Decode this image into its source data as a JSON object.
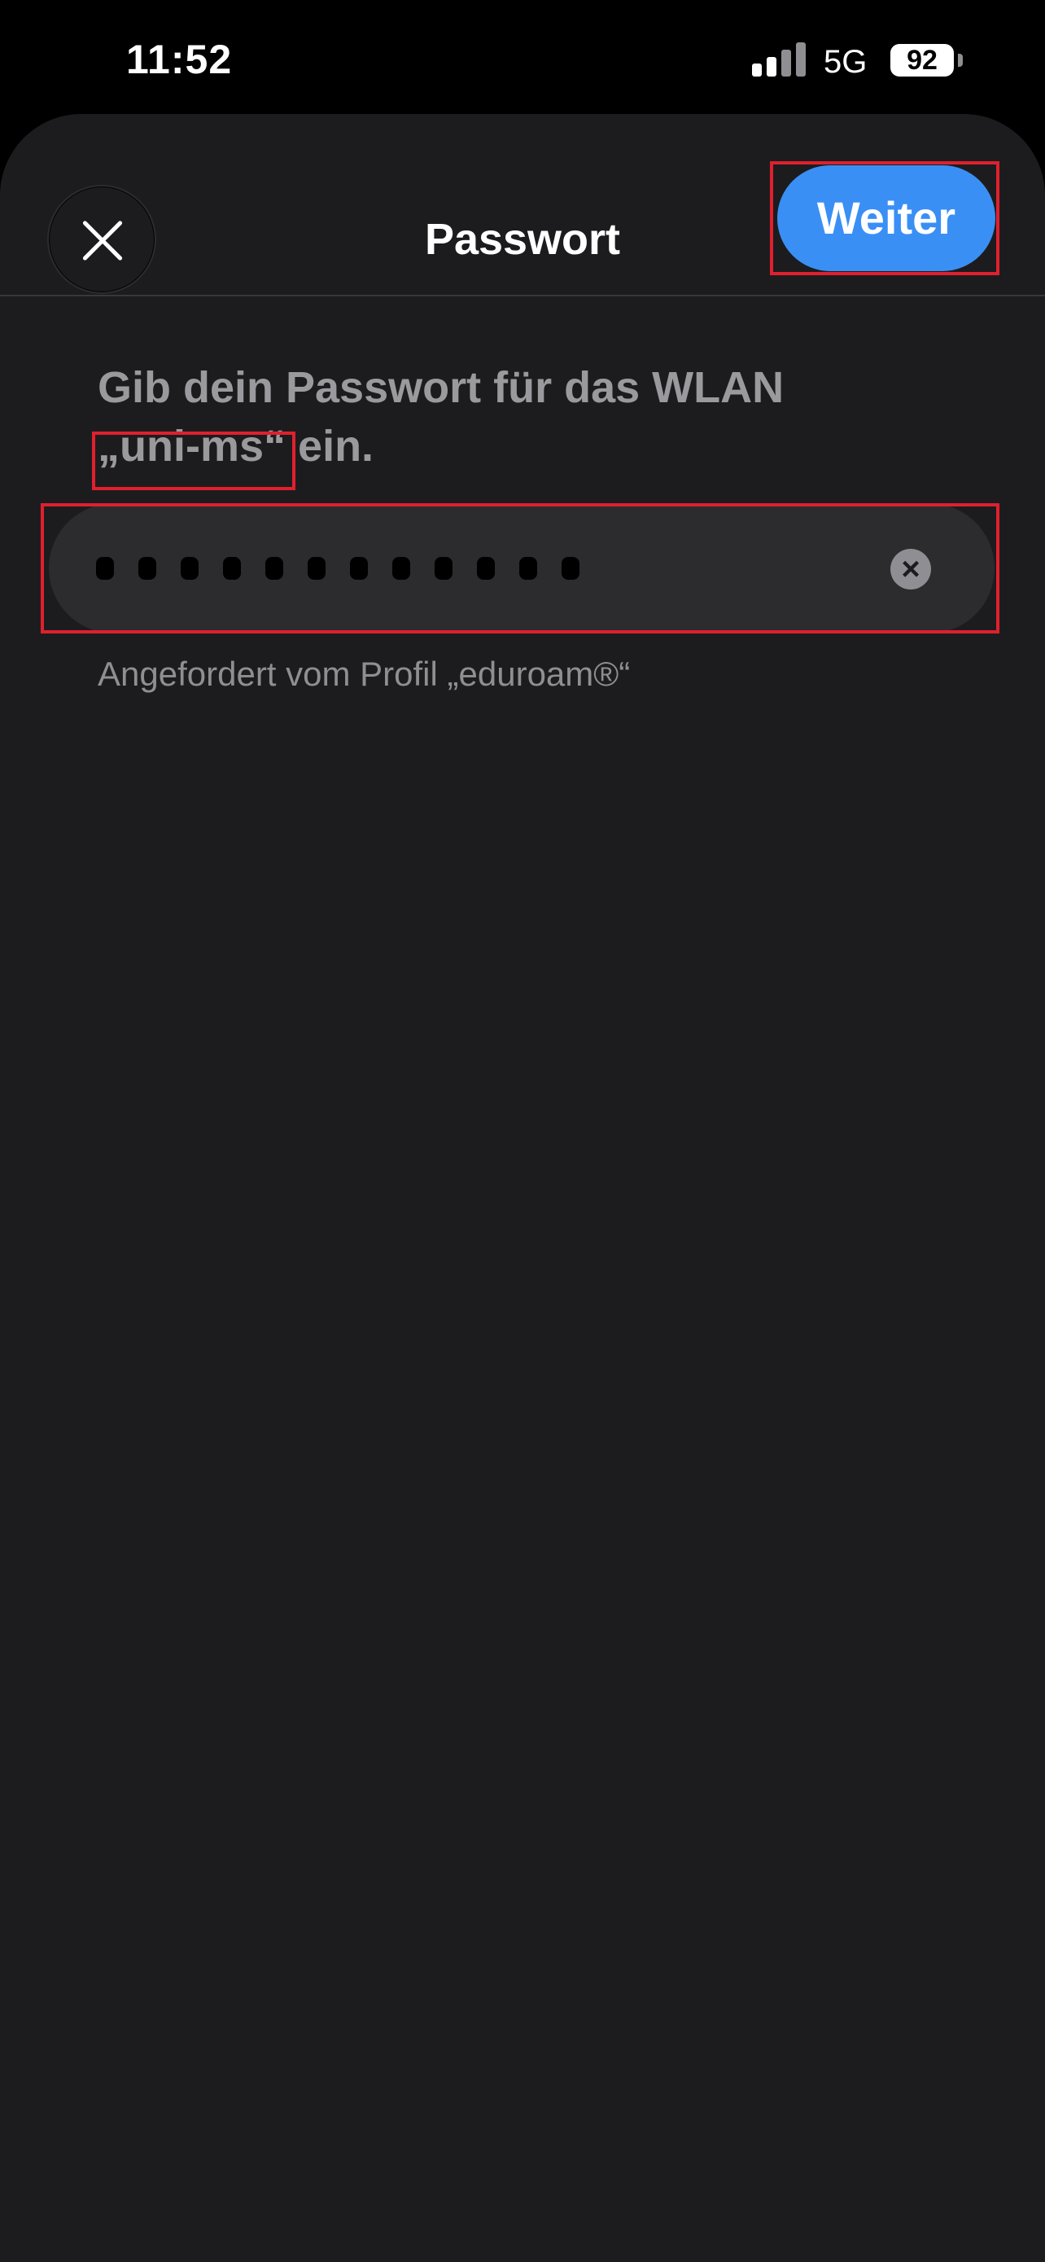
{
  "status_bar": {
    "time": "11:52",
    "network": "5G",
    "battery": "92"
  },
  "nav": {
    "title": "Passwort",
    "next_label": "Weiter",
    "close_icon": "close-icon"
  },
  "prompt": {
    "text_before": "Gib dein Passwort für das WLAN",
    "ssid": "„uni-ms“",
    "text_after": "ein."
  },
  "password_field": {
    "masked_length": 12,
    "clear_icon": "clear-icon"
  },
  "footnote": "Angefordert vom Profil „eduroam®“",
  "colors": {
    "accent": "#3a8ff5",
    "sheet_background": "#1c1c1e",
    "field_background": "#2c2c2e",
    "highlight": "#e0202e"
  }
}
